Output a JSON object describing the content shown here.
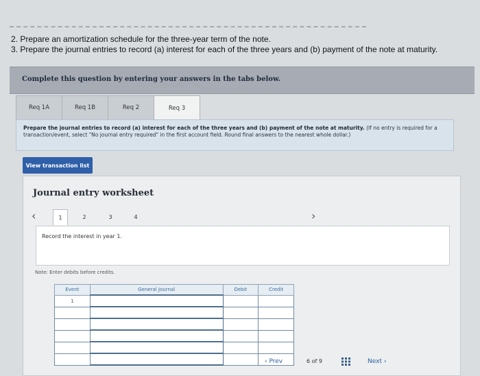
{
  "instructions": {
    "line2": "2. Prepare an amortization schedule for the three-year term of the note.",
    "line3": "3. Prepare the journal entries to record (a) interest for each of the three years and (b) payment of the note at maturity."
  },
  "banner": {
    "text": "Complete this question by entering your answers in the tabs below."
  },
  "tabs": [
    {
      "label": "Req 1A"
    },
    {
      "label": "Req 1B"
    },
    {
      "label": "Req 2"
    },
    {
      "label": "Req 3"
    }
  ],
  "prompt": {
    "bold": "Prepare the journal entries to record (a) interest for each of the three years and (b) payment of the note at maturity.",
    "normal": " (If no entry is required for a transaction/event, select \"No journal entry required\" in the first account field. Round final answers to the nearest whole dollar.)"
  },
  "view_button": {
    "label": "View transaction list"
  },
  "worksheet": {
    "title": "Journal entry worksheet",
    "pages": [
      "1",
      "2",
      "3",
      "4"
    ],
    "record_text": "Record the interest in year 1.",
    "note": "Note: Enter debits before credits.",
    "table": {
      "headers": [
        "Event",
        "General Journal",
        "Debit",
        "Credit"
      ],
      "first_event": "1"
    }
  },
  "navigation": {
    "prev": "Prev",
    "page_current": "6",
    "page_of": "of",
    "page_total": "9",
    "next": "Next"
  }
}
